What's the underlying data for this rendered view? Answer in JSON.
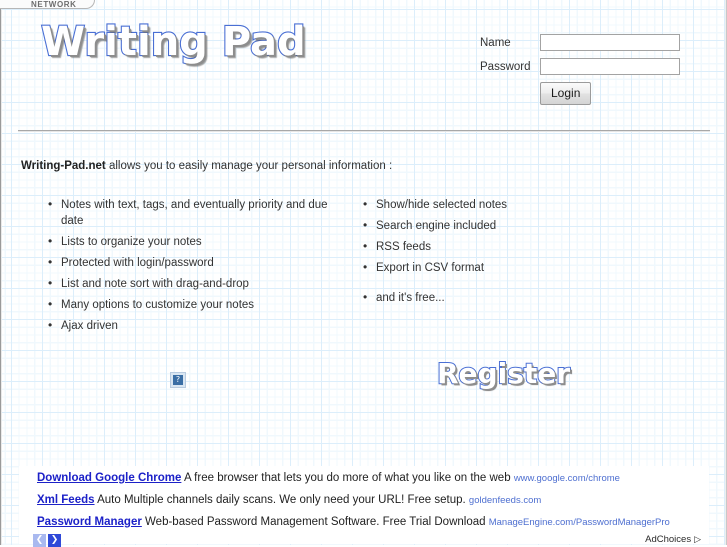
{
  "browser_tab": {
    "label": "NETWORK"
  },
  "header": {
    "logo_text": "Writing Pad"
  },
  "login": {
    "name_label": "Name",
    "name_value": "",
    "name_placeholder": "",
    "password_label": "Password",
    "password_value": "",
    "password_placeholder": "",
    "login_button": "Login"
  },
  "intro": {
    "brand": "Writing-Pad.net",
    "text": " allows you to easily manage your personal information :"
  },
  "features": {
    "left": [
      "Notes with text, tags, and eventually priority and due date",
      "Lists to organize your notes",
      "Protected with login/password",
      "List and note sort with drag-and-drop",
      "Many options to customize your notes",
      "Ajax driven"
    ],
    "right": [
      "Show/hide selected notes",
      "Search engine included",
      "RSS feeds",
      "Export in CSV format",
      "and it's free..."
    ]
  },
  "register": {
    "label": "Register"
  },
  "broken_image": {
    "glyph": "?"
  },
  "ads": {
    "items": [
      {
        "title": "Download Google Chrome",
        "description": "A free browser that lets you do more of what you like on the web",
        "url": "www.google.com/chrome"
      },
      {
        "title": "Xml Feeds",
        "description": "Auto Multiple channels daily scans. We only need your URL! Free setup.",
        "url": "goldenfeeds.com"
      },
      {
        "title": "Password Manager",
        "description": "Web-based Password Management Software. Free Trial Download",
        "url": "ManageEngine.com/PasswordManagerPro"
      }
    ],
    "prev_arrow": "❮",
    "next_arrow": "❯",
    "adchoices_label": "AdChoices",
    "adchoices_icon": "▷"
  },
  "colors": {
    "logo_outline": "#4a6fd4",
    "grid_major": "#dceefb",
    "grid_minor": "#f0f8fd",
    "ad_link": "#1c21c8",
    "ad_url": "#4e6fd0",
    "arrow_active": "#2f49d8",
    "arrow_disabled": "#a9b9ef"
  }
}
